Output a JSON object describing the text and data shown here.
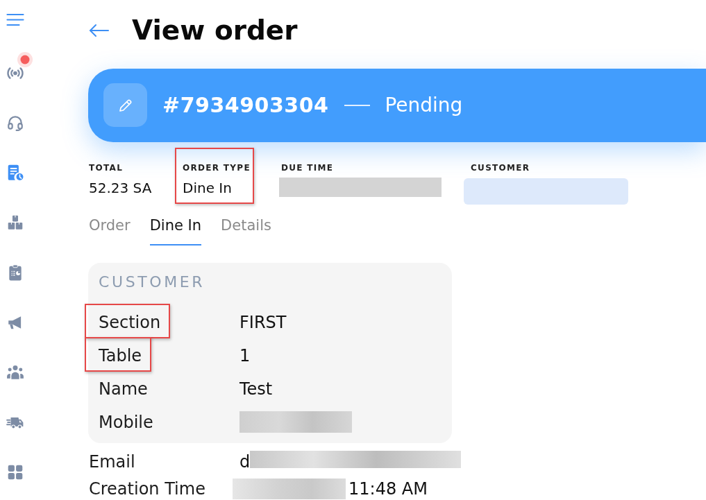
{
  "sidebar": {
    "items": [
      {
        "selected": false,
        "alert": true
      },
      {
        "selected": false,
        "alert": false
      },
      {
        "selected": true,
        "alert": false
      },
      {
        "selected": false,
        "alert": false
      },
      {
        "selected": false,
        "alert": false
      },
      {
        "selected": false,
        "alert": false
      },
      {
        "selected": false,
        "alert": false
      },
      {
        "selected": false,
        "alert": false
      },
      {
        "selected": false,
        "alert": false
      }
    ]
  },
  "header": {
    "title": "View order"
  },
  "order_banner": {
    "number": "#7934903304",
    "status": "Pending"
  },
  "summary": [
    {
      "label": "TOTAL",
      "value": "52.23 SA",
      "highlighted": false
    },
    {
      "label": "ORDER TYPE",
      "value": "Dine In",
      "highlighted": true
    },
    {
      "label": "DUE TIME",
      "blurred": true,
      "color": "#d4d4d4",
      "highlighted": false
    },
    {
      "label": "CUSTOMER",
      "blurred": true,
      "color": "#dde9fb",
      "highlighted": false
    }
  ],
  "tabs": [
    {
      "label": "Order",
      "selected": false
    },
    {
      "label": "Dine In",
      "selected": true
    },
    {
      "label": "Details",
      "selected": false
    }
  ],
  "customer_card": {
    "title": "CUSTOMER",
    "rows": [
      {
        "label": "Section",
        "value": "FIRST",
        "highlighted": true
      },
      {
        "label": "Table",
        "value": "1",
        "highlighted": true
      },
      {
        "label": "Name",
        "value": "Test",
        "highlighted": false
      },
      {
        "label": "Mobile",
        "parts": [
          {
            "kind": "blur"
          }
        ],
        "highlighted": false
      }
    ]
  },
  "details": [
    {
      "label": "Email",
      "parts": [
        {
          "kind": "text",
          "text": "d"
        },
        {
          "kind": "blur"
        }
      ],
      "highlighted": false
    },
    {
      "label": "Creation Time",
      "parts": [
        {
          "kind": "blur"
        },
        {
          "kind": "text",
          "text": "11:48 AM"
        }
      ],
      "highlighted": false
    }
  ]
}
